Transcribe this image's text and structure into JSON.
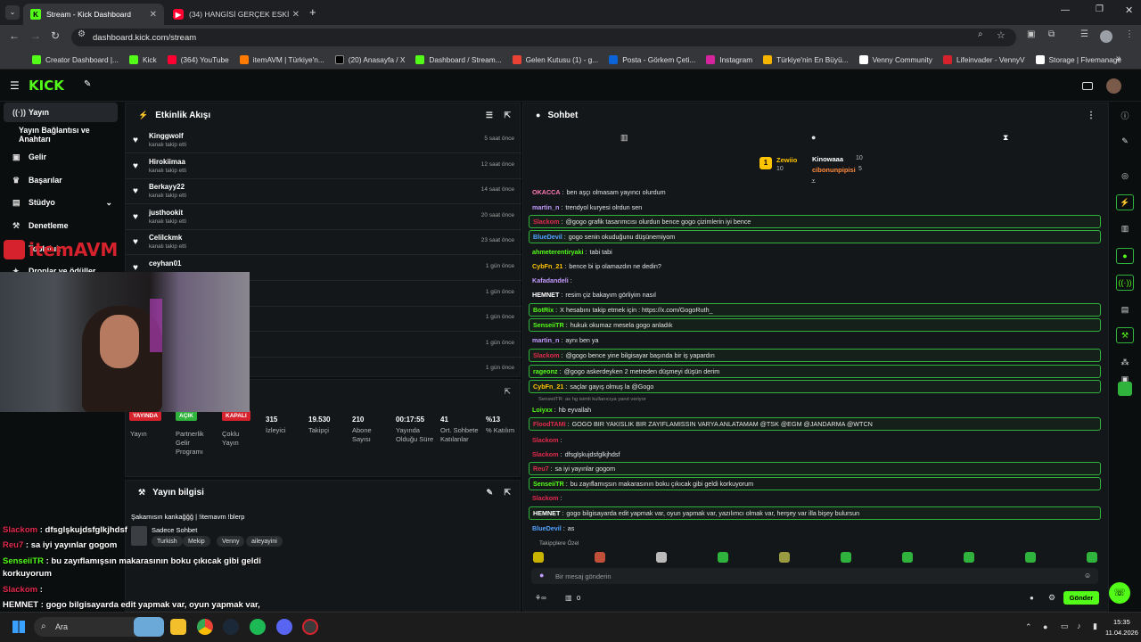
{
  "browser": {
    "tabs": [
      {
        "label": "Stream - Kick Dashboard"
      },
      {
        "label": "(34) HANGİSİ GERÇEK ESKİ SEV"
      }
    ],
    "url": "dashboard.kick.com/stream",
    "bookmarks": [
      "Creator Dashboard |...",
      "Kick",
      "(364) YouTube",
      "itemAVM | Türkiye'n...",
      "(20) Anasayfa / X",
      "Dashboard / Stream...",
      "Gelen Kutusu (1) - g...",
      "Posta - Görkem Çeti...",
      "Instagram",
      "Türkiye'nin En Büyü...",
      "Venny Community",
      "Lifeinvader - VennyV",
      "Storage | Fivemanage"
    ]
  },
  "app": {
    "logo": "KICK"
  },
  "sidebar": {
    "items": [
      {
        "label": "Yayın",
        "icon": "broadcast-icon"
      },
      {
        "label": "Yayın Bağlantısı ve Anahtarı",
        "icon": ""
      },
      {
        "label": "Gelir",
        "icon": "wallet-icon"
      },
      {
        "label": "Başarılar",
        "icon": "trophy-icon"
      },
      {
        "label": "Stüdyo",
        "icon": "studio-icon"
      },
      {
        "label": "Denetleme",
        "icon": "hammer-icon"
      },
      {
        "label": "Topluluk",
        "icon": "people-icon"
      },
      {
        "label": "Droplar ve ödüller",
        "icon": "gift-icon"
      }
    ]
  },
  "activity": {
    "title": "Etkinlik Akışı",
    "events": [
      {
        "name": "Kinggwolf",
        "sub": "kanalı takip etti",
        "time": "5 saat önce"
      },
      {
        "name": "Hirokiimaa",
        "sub": "kanalı takip etti",
        "time": "12 saat önce"
      },
      {
        "name": "Berkayy22",
        "sub": "kanalı takip etti",
        "time": "14 saat önce"
      },
      {
        "name": "justhookit",
        "sub": "kanalı takip etti",
        "time": "20 saat önce"
      },
      {
        "name": "Celilckmk",
        "sub": "kanalı takip etti",
        "time": "23 saat önce"
      },
      {
        "name": "ceyhan01",
        "sub": "",
        "time": "1 gün önce"
      },
      {
        "name": "",
        "sub": "",
        "time": "1 gün önce"
      },
      {
        "name": "",
        "sub": "",
        "time": "1 gün önce"
      },
      {
        "name": "",
        "sub": "",
        "time": "1 gün önce"
      },
      {
        "name": "",
        "sub": "",
        "time": "1 gün önce"
      }
    ]
  },
  "stats": {
    "badges": [
      {
        "label": "YAYINDA",
        "color": "#d6222c",
        "caption": "Yayın"
      },
      {
        "label": "AÇIK",
        "color": "#2fb33c",
        "caption": "Partnerlik Gelir Programı"
      },
      {
        "label": "KAPALI",
        "color": "#d6222c",
        "caption": "Çoklu Yayın"
      }
    ],
    "items": [
      {
        "value": "315",
        "label": "İzleyici"
      },
      {
        "value": "19.530",
        "label": "Takipçi"
      },
      {
        "value": "210",
        "label": "Abone Sayısı"
      },
      {
        "value": "00:17:55",
        "label": "Yayında Olduğu Süre"
      },
      {
        "value": "41",
        "label": "Ort. Sohbete Katılanlar"
      },
      {
        "value": "%13",
        "label": "% Katılım"
      }
    ]
  },
  "streaminfo": {
    "title": "Yayın bilgisi",
    "stream_title": "Şakamısın kankağğğ | !itemavm !blerp",
    "category": "Sadece Sohbet",
    "tags": [
      "Turkish",
      "Mekip",
      "Venny",
      "aileyayini"
    ]
  },
  "chat": {
    "title": "Sohbet",
    "top": {
      "first": "Zewiio",
      "first_count": "10",
      "second": "Kinowaaa",
      "second_count": "10",
      "third": "cibonunpipisi",
      "third_count": "5"
    },
    "messages": [
      {
        "user": "OKACCA",
        "color": "#ff7ab6",
        "text": "ben aşçı olmasam yayıncı olurdum",
        "style": ""
      },
      {
        "user": "martin_n",
        "color": "#c49bff",
        "text": "trendyol kuryesi olrdun sen",
        "style": ""
      },
      {
        "user": "Slackom",
        "color": "#e0294c",
        "text": "@gogo grafik tasarımcısı olurdun bence gogo çizimlerin iyi bence",
        "style": "hl"
      },
      {
        "user": "BlueDevil",
        "color": "#4fa3ff",
        "text": "gogo senin okuduğunu düşünemiyom",
        "style": "hl"
      },
      {
        "user": "ahmeterentiryaki",
        "color": "#53fc18",
        "text": "tabi tabi",
        "style": ""
      },
      {
        "user": "CybFn_21",
        "color": "#ffc400",
        "text": "bence bi ip olamazdın ne dedin?",
        "style": ""
      },
      {
        "user": "Kafadandeli",
        "color": "#c49bff",
        "text": "",
        "style": ""
      },
      {
        "user": "HEMNET",
        "color": "#ffffff",
        "text": "resim çiz bakayım görliyim nasıl",
        "style": ""
      },
      {
        "user": "BotRix",
        "color": "#53fc18",
        "text": "X hesabını takip etmek için : https://x.com/GogoRuth_",
        "style": "hl"
      },
      {
        "user": "SenseiiTR",
        "color": "#53fc18",
        "text": "hukuk okumaz mesela gogo anladık",
        "style": "hl"
      },
      {
        "user": "martin_n",
        "color": "#c49bff",
        "text": "aynı ben ya",
        "style": ""
      },
      {
        "user": "Slackom",
        "color": "#e0294c",
        "text": "@gogo bence yine bilgisayar başında bir iş yapardın",
        "style": "hl"
      },
      {
        "user": "rageonz",
        "color": "#53fc18",
        "text": "@gogo askerdeyken 2 metreden düşmeyi düşün derim",
        "style": "hl"
      },
      {
        "user": "CybFn_21",
        "color": "#ffc400",
        "text": "saçlar gayış olmuş la @Gogo",
        "style": "hl"
      },
      {
        "user": "Loiyxx",
        "color": "#53fc18",
        "text": "hb eyvallah",
        "style": ""
      },
      {
        "user": "FloodTAMI",
        "color": "#e0294c",
        "text": "GOGO BIR YAKISLIK BIR ZAYIFLAMISSIN VARYA ANLATAMAM @TSK @EGM @JANDARMA @WTCN",
        "style": "hl"
      },
      {
        "user": "Slackom",
        "color": "#e0294c",
        "text": "",
        "style": ""
      },
      {
        "user": "Slackom",
        "color": "#e0294c",
        "text": "dfsglşkujdsfglkjhdsf",
        "style": ""
      },
      {
        "user": "Reu7",
        "color": "#e0294c",
        "text": "sa iyi yayınlar gogom",
        "style": "hl"
      },
      {
        "user": "SenseiiTR",
        "color": "#53fc18",
        "text": "bu zayıflamışsın makarasının boku çıkıcak gibi geldi korkuyorum",
        "style": "hl2"
      },
      {
        "user": "Slackom",
        "color": "#e0294c",
        "text": "",
        "style": ""
      },
      {
        "user": "HEMNET",
        "color": "#ffffff",
        "text": "gogo bilgisayarda edit yapmak var, oyun yapmak var, yazılımcı olmak var, herşey var illa bişey bulursun",
        "style": "hl"
      },
      {
        "user": "BlueDevil",
        "color": "#4fa3ff",
        "text": "as",
        "style": ""
      }
    ],
    "reply_note": "SenseiiTR: as hg isimli kullanıcıya yanıt veriyor",
    "emote_section": "Takipçilere Özel",
    "input_placeholder": "Bir mesaj gönderin",
    "send_label": "Gönder",
    "count": "0"
  },
  "overlay": {
    "sponsor": "itemAVM",
    "lines": [
      {
        "user": "Slackom",
        "color": "#e0294c",
        "text": "dfsglşkujdsfglkjhdsf"
      },
      {
        "user": "Reu7",
        "color": "#e0294c",
        "text": "sa iyi yayınlar gogom"
      },
      {
        "user": "SenseiiTR",
        "color": "#53fc18",
        "text": "bu zayıflamışsın makarasının boku çıkıcak gibi geldi korkuyorum"
      },
      {
        "user": "Slackom",
        "color": "#e0294c",
        "text": ""
      },
      {
        "user": "HEMNET",
        "color": "#ffffff",
        "text": "gogo bilgisayarda edit yapmak var, oyun yapmak var, yazılımcı olmak var, herşey var illa bişey bulursun"
      }
    ]
  },
  "taskbar": {
    "search": "Ara",
    "time": "15:35",
    "date": "11.04.2026"
  }
}
